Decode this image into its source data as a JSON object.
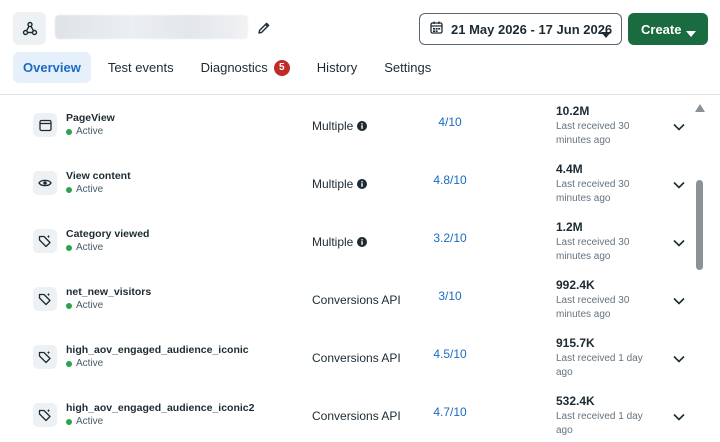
{
  "header": {
    "icons": {
      "pixel": "pixel-network-icon",
      "edit": "pencil-icon",
      "calendar": "calendar-icon",
      "caret": "caret-down-icon"
    },
    "date_range": "21 May 2026 - 17 Jun 2026",
    "create_label": "Create"
  },
  "tabs": [
    {
      "label": "Overview",
      "active": true
    },
    {
      "label": "Test events"
    },
    {
      "label": "Diagnostics",
      "badge": "5"
    },
    {
      "label": "History"
    },
    {
      "label": "Settings"
    }
  ],
  "events": [
    {
      "name": "PageView",
      "status": "Active",
      "icon": "browser-window-icon",
      "source": "Multiple",
      "source_info": true,
      "score": "4/10",
      "count": "10.2M",
      "last_received": "Last received 30 minutes ago"
    },
    {
      "name": "View content",
      "status": "Active",
      "icon": "eye-icon",
      "source": "Multiple",
      "source_info": true,
      "score": "4.8/10",
      "count": "4.4M",
      "last_received": "Last received 30 minutes ago"
    },
    {
      "name": "Category viewed",
      "status": "Active",
      "icon": "custom-tag-icon",
      "source": "Multiple",
      "source_info": true,
      "score": "3.2/10",
      "count": "1.2M",
      "last_received": "Last received 30 minutes ago"
    },
    {
      "name": "net_new_visitors",
      "status": "Active",
      "icon": "custom-tag-icon",
      "source": "Conversions API",
      "source_info": false,
      "score": "3/10",
      "count": "992.4K",
      "last_received": "Last received 30 minutes ago"
    },
    {
      "name": "high_aov_engaged_audience_iconic",
      "status": "Active",
      "icon": "custom-tag-icon",
      "source": "Conversions API",
      "source_info": false,
      "score": "4.5/10",
      "count": "915.7K",
      "last_received": "Last received 1 day ago"
    },
    {
      "name": "high_aov_engaged_audience_iconic2",
      "status": "Active",
      "icon": "custom-tag-icon",
      "source": "Conversions API",
      "source_info": false,
      "score": "4.7/10",
      "count": "532.4K",
      "last_received": "Last received 1 day ago"
    }
  ],
  "colors": {
    "primary": "#1a6b3f",
    "link": "#1a6bc4",
    "active_dot": "#2aa44f",
    "badge": "#c22a2a",
    "tab_active_bg": "#e6f0fb"
  }
}
